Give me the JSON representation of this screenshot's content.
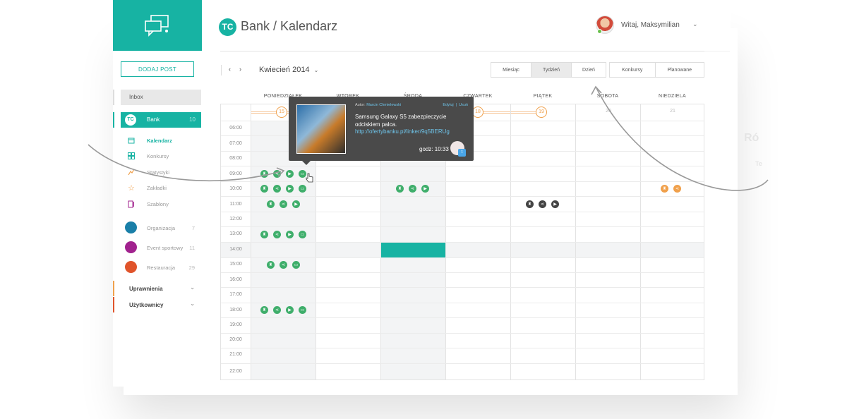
{
  "sidebar": {
    "add_post": "DODAJ POST",
    "inbox": "Inbox",
    "bank": {
      "label": "Bank",
      "count": "10",
      "logo": "TC"
    },
    "subnav": [
      {
        "label": "Kalendarz",
        "icon": "calendar-icon",
        "active": true
      },
      {
        "label": "Konkursy",
        "icon": "grid-icon",
        "active": false
      },
      {
        "label": "Statystyki",
        "icon": "chart-icon",
        "active": false
      },
      {
        "label": "Zakładki",
        "icon": "star-icon",
        "active": false
      },
      {
        "label": "Szablony",
        "icon": "document-icon",
        "active": false
      }
    ],
    "organizations": [
      {
        "label": "Organizacja",
        "count": "7",
        "color": "#1a7fa8"
      },
      {
        "label": "Event sportowy",
        "count": "11",
        "color": "#a1228e"
      },
      {
        "label": "Restauracja",
        "count": "29",
        "color": "#e0542b"
      }
    ],
    "sections": [
      {
        "label": "Uprawnienia",
        "color": "#f0a04b"
      },
      {
        "label": "Użytkownicy",
        "color": "#e0542b"
      }
    ]
  },
  "header": {
    "logo": "TC",
    "title": "Bank / Kalendarz",
    "user_name": "Witaj, Maksymilian"
  },
  "toolbar": {
    "prev": "‹",
    "next": "›",
    "month": "Kwiecień 2014",
    "view_tabs": [
      "Miesiąc",
      "Tydzień",
      "Dzień"
    ],
    "active_view": "Tydzień",
    "filter_tabs": [
      "Konkursy",
      "Planowane"
    ]
  },
  "calendar": {
    "days": [
      "PONIEDZIAŁEK",
      "WTOREK",
      "ŚRODA",
      "CZWARTEK",
      "PIĄTEK",
      "SOBOTA",
      "NIEDZIELA"
    ],
    "dates": [
      "15",
      "16",
      "17",
      "18",
      "19",
      "20",
      "21"
    ],
    "times": [
      "06:00",
      "07:00",
      "08:00",
      "09:00",
      "10:00",
      "11:00",
      "12:00",
      "13:00",
      "14:00",
      "15:00",
      "16:00",
      "17:00",
      "18:00",
      "19:00",
      "20:00",
      "21:00",
      "22:00"
    ]
  },
  "popup": {
    "author_label": "Autor:",
    "author_name": "Marcin Chmielewski",
    "edit": "Edytuj",
    "delete": "Usuń",
    "text": "Samsung Galaxy S5 zabezpieczycie odciskiem palca.",
    "url": "http://ofertybanku.pl/linker/9q5BERUg",
    "time": "godz: 10:33"
  },
  "colors": {
    "accent": "#17b3a3",
    "event_green": "#3fae6b",
    "event_orange": "#f0a04b",
    "event_dark": "#444444"
  }
}
